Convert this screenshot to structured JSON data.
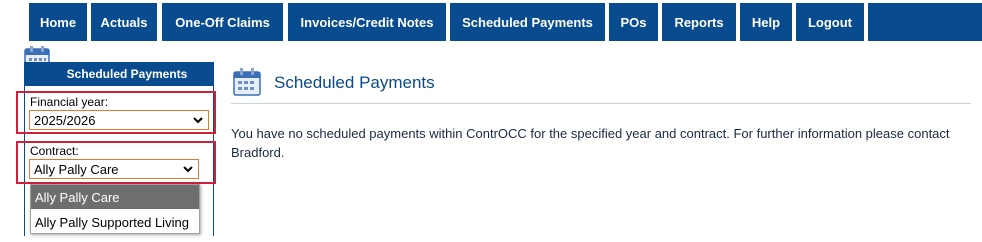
{
  "nav": {
    "items": [
      "Home",
      "Actuals",
      "One-Off Claims",
      "Invoices/Credit Notes",
      "Scheduled Payments",
      "POs",
      "Reports",
      "Help",
      "Logout"
    ]
  },
  "sidebar": {
    "heading": "Scheduled Payments",
    "financial_year_label": "Financial year:",
    "financial_year_value": "2025/2026",
    "contract_label": "Contract:",
    "contract_value": "Ally Pally Care",
    "contract_options": [
      "Ally Pally Care",
      "Ally Pally Supported Living"
    ]
  },
  "main": {
    "title": "Scheduled Payments",
    "message": "You have no scheduled payments within ContrOCC for the specified year and contract. For further information please contact Bradford."
  },
  "colors": {
    "nav_bg": "#084b8f",
    "highlight_border": "#d21f3c",
    "select_border": "#e07a2e",
    "title": "#0a4a8c"
  }
}
